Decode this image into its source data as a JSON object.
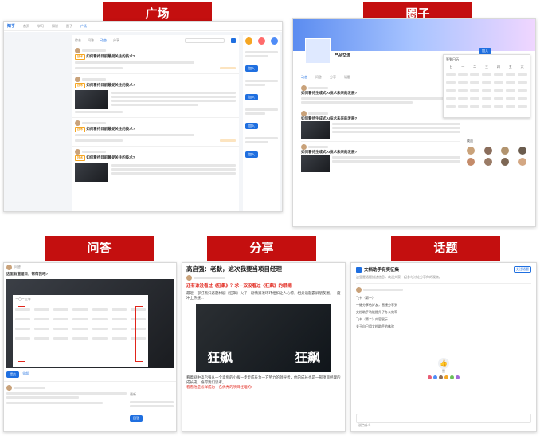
{
  "labels": {
    "plaza": "广场",
    "circle": "圈子",
    "qa": "问答",
    "share": "分享",
    "topic": "话题"
  },
  "plaza_panel": {
    "logo": "知乎",
    "nav": [
      "首页",
      "学习",
      "知识",
      "圈子",
      "广场"
    ],
    "tabs": [
      "综合",
      "问答",
      "动态",
      "分享"
    ],
    "posts": [
      {
        "title": "如何看待目前最受关注的技术?",
        "tag": "技术"
      },
      {
        "title": "如何看待目前最受关注的技术?",
        "tag": "技术"
      },
      {
        "title": "如何看待目前最受关注的技术?",
        "tag": "技术"
      },
      {
        "title": "如何看待目前最受关注的技术?",
        "tag": "技术"
      }
    ],
    "side_btn": "加入"
  },
  "circle_panel": {
    "circle_name": "产品交流",
    "join_btn": "加入",
    "post_title": "如何看待生成式AI技术未来的发展?",
    "tabs": [
      "动态",
      "问答",
      "分享",
      "话题"
    ],
    "calendar_title": "签到日历",
    "weekdays": [
      "日",
      "一",
      "二",
      "三",
      "四",
      "五",
      "六"
    ],
    "members_title": "成员"
  },
  "qa_panel": {
    "title": "问答",
    "question": "这里有道题目，帮帮我吧?",
    "calendar_header": "二〇二三年",
    "tabs": [
      "全部",
      "最新"
    ],
    "submit": "提交",
    "answer_btn": "回答"
  },
  "share_panel": {
    "headline": "高启强：老默，这次我要当项目经理",
    "subtitle": "还有谁没看过《狂飙》？求一双没看过《狂飙》的眼睛",
    "body1": "最近一部打黑扫恶题材剧《狂飙》火了，剧情紧凑环环相扣让人心惊，相关话题霸屏朋友圈，一度冲上热搜...",
    "poster_title_left": "狂飙",
    "poster_title_right": "狂飙",
    "body2": "看着剧中高启强从一个卖鱼的小贩一步步成长为一方势力的领导者，他的成长也是一部项目经理的成长史，值得我们思考。",
    "highlight": "看看他是怎样成为一名优秀的项目经理的!"
  },
  "topic_panel": {
    "title": "文档助手有奖征集",
    "follow_btn": "关注话题",
    "desc": "这里是话题描述信息，欢迎大家一起参与讨论分享你的观点。",
    "lines": [
      "飞书（第一）",
      "一键分享给好友，直接分享到",
      "文档助手功能提升了办公效率",
      "飞书（第二）内容展示",
      "关于自己用文档助手的体验"
    ],
    "like_label": "赞",
    "comment_placeholder": "说点什么..."
  }
}
